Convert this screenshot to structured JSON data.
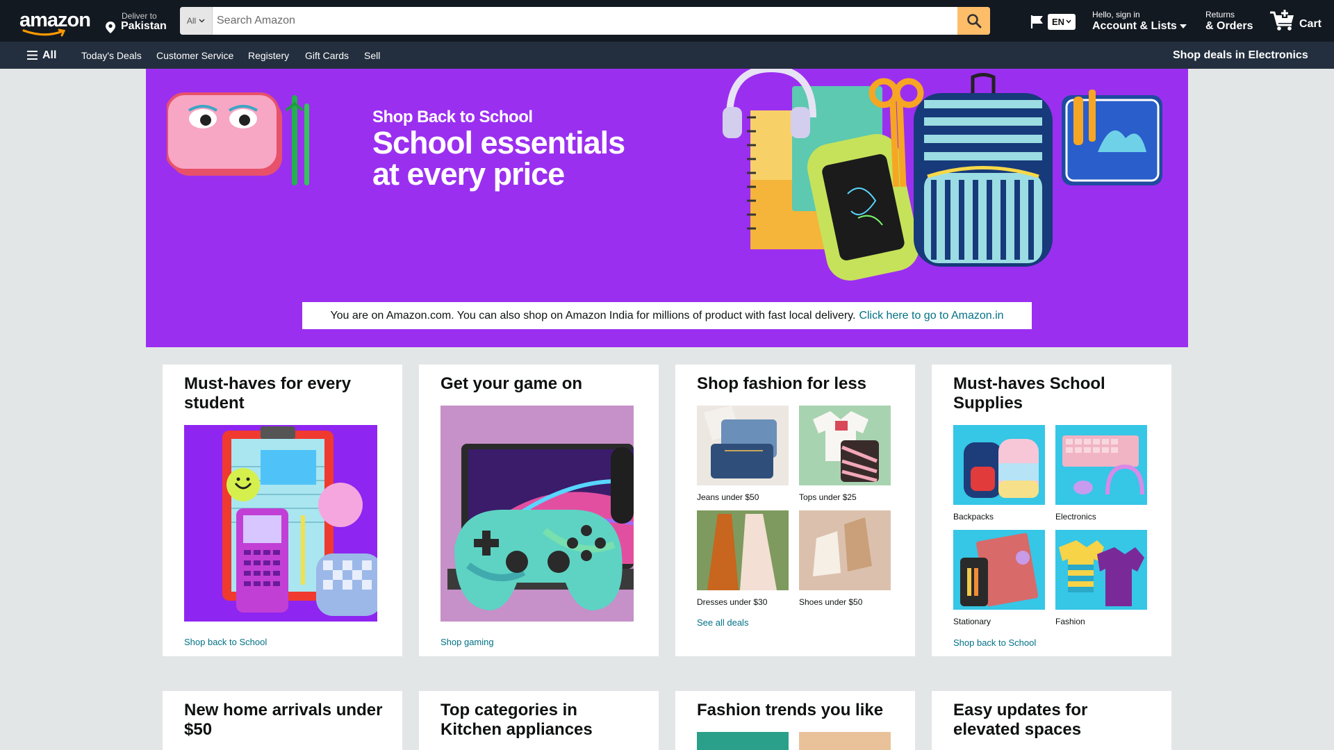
{
  "header": {
    "logo_text": "amazon",
    "deliver_to_label": "Deliver to",
    "deliver_to_location": "Pakistan",
    "search_category": "All",
    "search_placeholder": "Search Amazon",
    "language": "EN",
    "account_greeting": "Hello, sign in",
    "account_label": "Account & Lists",
    "returns_label": "Returns",
    "orders_label": "& Orders",
    "cart_label": "Cart",
    "cart_count": "0"
  },
  "subnav": {
    "all_label": "All",
    "items": [
      "Today's Deals",
      "Customer Service",
      "Registery",
      "Gift Cards",
      "Sell"
    ],
    "promo": "Shop deals in Electronics"
  },
  "hero": {
    "kicker": "Shop Back to School",
    "title_line1": "School essentials",
    "title_line2": "at every price",
    "notice_text": "You are on Amazon.com. You can also shop on Amazon India for millions of product with fast local delivery.",
    "notice_link": "Click here to go to Amazon.in"
  },
  "cards": [
    {
      "title": "Must-haves for every student",
      "link": "Shop back to School"
    },
    {
      "title": "Get your game on",
      "link": "Shop gaming"
    },
    {
      "title": "Shop fashion for less",
      "link": "See all deals",
      "tiles": [
        "Jeans under $50",
        "Tops under $25",
        "Dresses under $30",
        "Shoes under $50"
      ]
    },
    {
      "title": "Must-haves School Supplies",
      "link": "Shop back to School",
      "tiles": [
        "Backpacks",
        "Electronics",
        "Stationary",
        "Fashion"
      ]
    }
  ],
  "cards_row2": [
    {
      "title": "New home arrivals under $50"
    },
    {
      "title": "Top categories in Kitchen appliances"
    },
    {
      "title": "Fashion trends you like"
    },
    {
      "title": "Easy updates for elevated spaces"
    }
  ],
  "colors": {
    "nav_top": "#131921",
    "nav_sub": "#232f3e",
    "search_button": "#febd69",
    "hero_bg": "#9b2ff0",
    "link": "#007185"
  }
}
